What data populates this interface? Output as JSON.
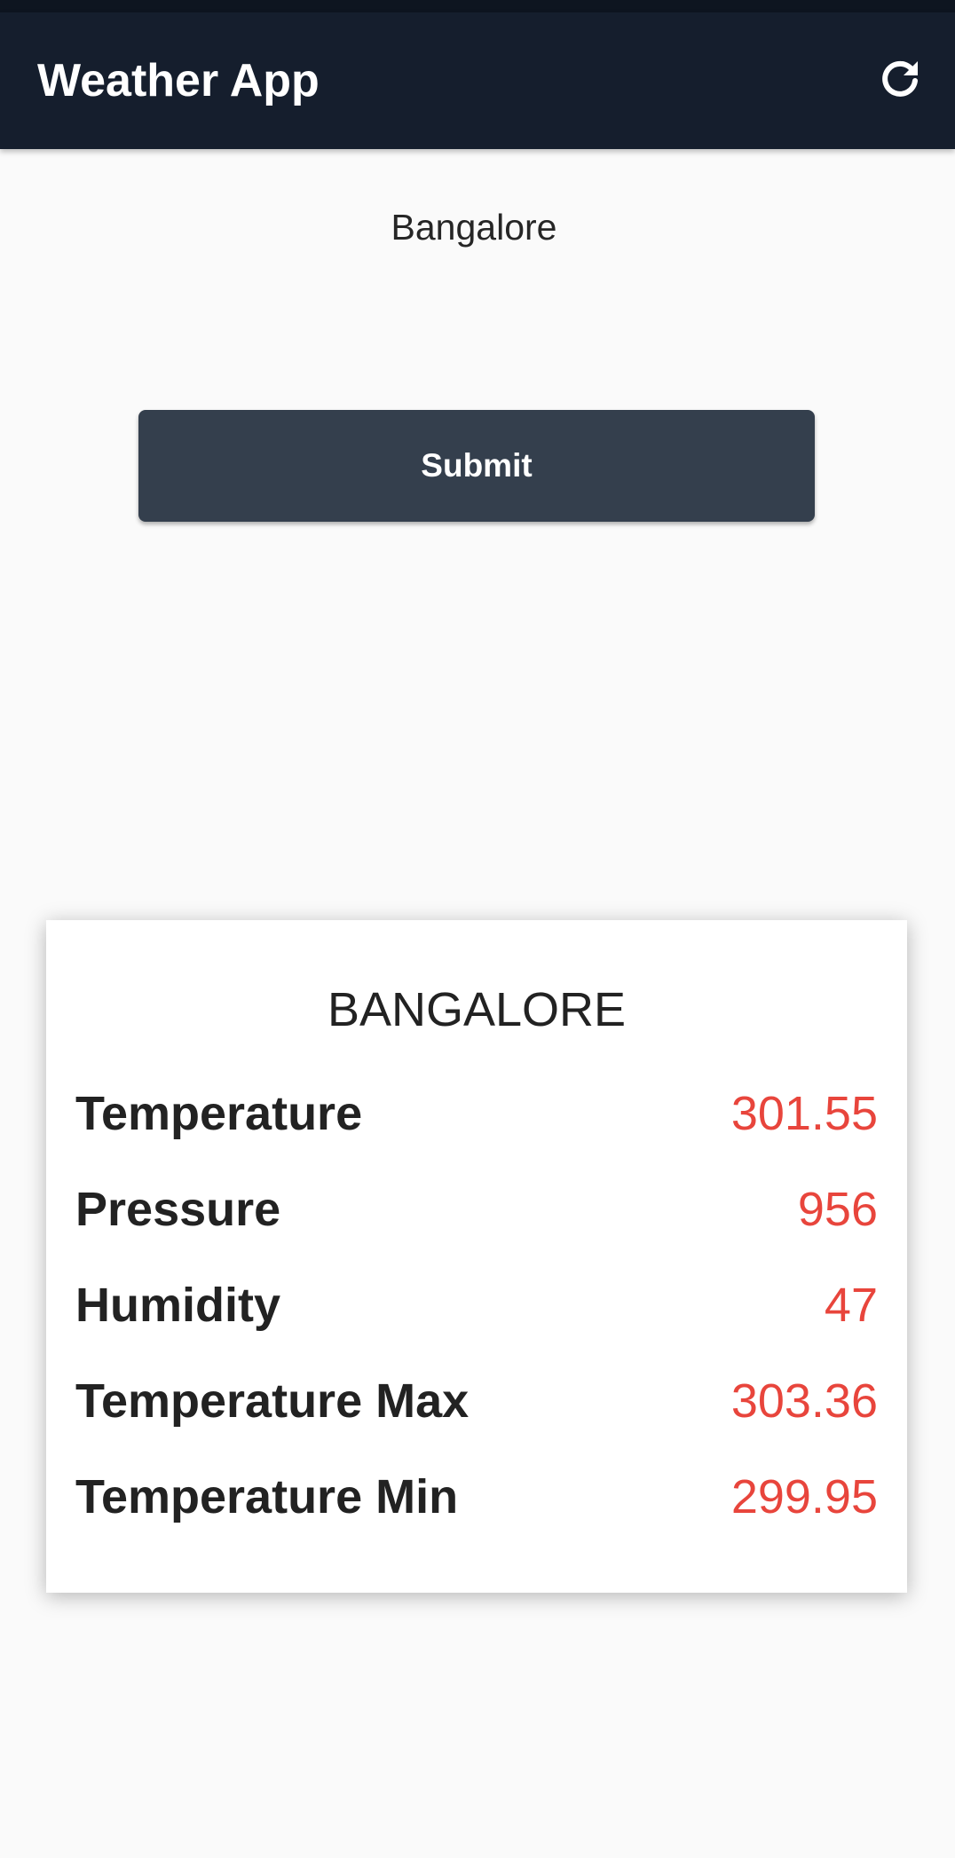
{
  "app_bar": {
    "title": "Weather App",
    "refresh_icon": "refresh-icon"
  },
  "search": {
    "value": "Bangalore",
    "submit_label": "Submit"
  },
  "weather_card": {
    "city": "BANGALORE",
    "rows": [
      {
        "label": "Temperature",
        "value": "301.55"
      },
      {
        "label": "Pressure",
        "value": "956"
      },
      {
        "label": "Humidity",
        "value": "47"
      },
      {
        "label": "Temperature Max",
        "value": "303.36"
      },
      {
        "label": "Temperature Min",
        "value": "299.95"
      }
    ]
  },
  "colors": {
    "app_bar": "#151e2d",
    "button": "#343f4d",
    "value_text": "#e8453c",
    "background": "#fafafa"
  }
}
